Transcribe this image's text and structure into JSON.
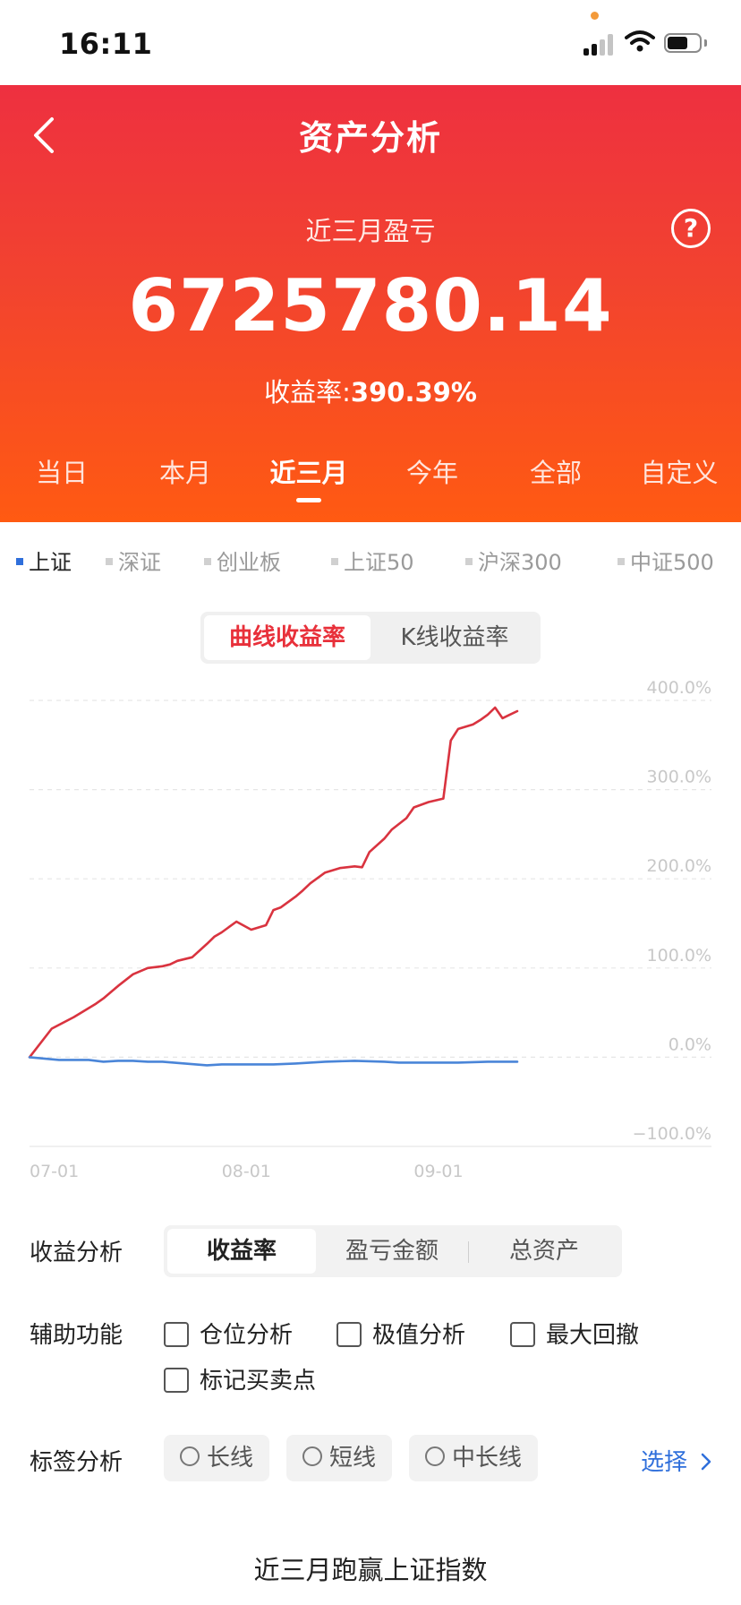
{
  "status_bar": {
    "time": "16:11"
  },
  "header": {
    "title": "资产分析",
    "profit_label": "近三月盈亏",
    "amount": "6725780.14",
    "rate_label": "收益率:",
    "rate_value": "390.39%",
    "help_icon": "?"
  },
  "periods": [
    "当日",
    "本月",
    "近三月",
    "今年",
    "全部",
    "自定义"
  ],
  "active_period": "近三月",
  "indices": [
    "上证",
    "深证",
    "创业板",
    "上证50",
    "沪深300",
    "中证500"
  ],
  "active_index": "上证",
  "chart_modes": {
    "curve": "曲线收益率",
    "kline": "K线收益率"
  },
  "colors": {
    "accent": "#e8303a",
    "portfolio_line": "#d9333f",
    "index_line": "#4a85d8",
    "link": "#2f6fdb"
  },
  "chart_data": {
    "type": "line",
    "xlabel": "",
    "ylabel": "",
    "ylim": [
      -100,
      400
    ],
    "y_ticks": [
      "400.0%",
      "300.0%",
      "200.0%",
      "100.0%",
      "0.0%",
      "−100.0%"
    ],
    "x_ticks": [
      "07-01",
      "08-01",
      "09-01"
    ],
    "grid": true,
    "x_day_range": [
      0,
      64
    ],
    "series": [
      {
        "x": [
          0,
          3,
          6,
          9,
          10,
          11,
          12,
          14,
          16,
          18,
          19,
          20,
          22,
          24,
          25,
          26,
          28,
          30,
          32,
          33,
          34,
          36,
          37,
          38,
          40,
          42,
          44,
          45,
          46,
          48,
          49,
          51,
          52,
          54,
          56,
          57,
          58,
          60,
          61,
          62,
          63,
          64,
          65,
          66
        ],
        "y": [
          0,
          32,
          45,
          60,
          66,
          73,
          80,
          93,
          100,
          102,
          104,
          108,
          112,
          127,
          135,
          140,
          152,
          143,
          148,
          165,
          168,
          180,
          187,
          195,
          207,
          212,
          214,
          213,
          230,
          245,
          255,
          268,
          280,
          286,
          290,
          355,
          368,
          373,
          378,
          384,
          392,
          380,
          384,
          388
        ]
      },
      {
        "x": [
          0,
          4,
          8,
          10,
          12,
          14,
          16,
          18,
          21,
          24,
          26,
          28,
          30,
          33,
          36,
          40,
          44,
          48,
          50,
          54,
          58,
          62,
          66
        ],
        "y": [
          0,
          -3,
          -3,
          -5,
          -4,
          -4,
          -5,
          -5,
          -7,
          -9,
          -8,
          -8,
          -8,
          -8,
          -7,
          -5,
          -4,
          -5,
          -6,
          -6,
          -6,
          -5,
          -5
        ]
      }
    ]
  },
  "analysis": {
    "label": "收益分析",
    "options": [
      "收益率",
      "盈亏金额",
      "总资产"
    ],
    "active": "收益率"
  },
  "aux": {
    "label": "辅助功能",
    "items": [
      "仓位分析",
      "极值分析",
      "最大回撤",
      "标记买卖点"
    ]
  },
  "tags": {
    "label": "标签分析",
    "items": [
      "长线",
      "短线",
      "中长线"
    ],
    "select": "选择"
  },
  "bottom_title": "近三月跑赢上证指数"
}
